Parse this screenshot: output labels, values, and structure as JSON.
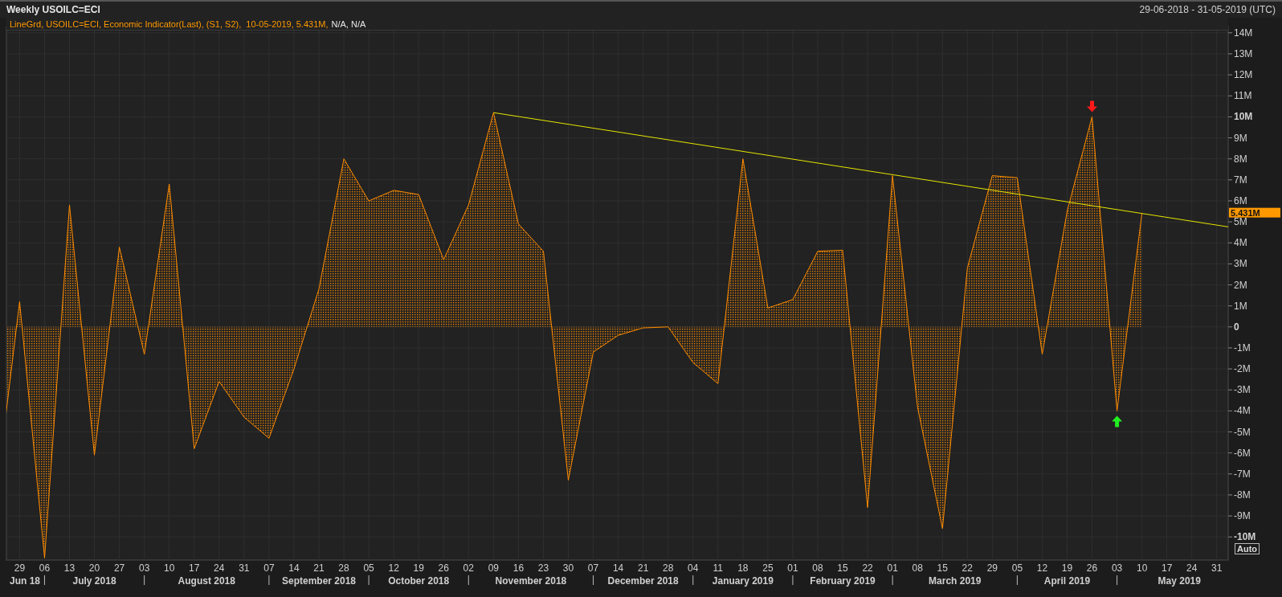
{
  "window": {
    "title": "Weekly USOILC=ECI",
    "date_range": "29-06-2018 - 31-05-2019 (UTC)"
  },
  "legend": {
    "series_text": "LineGrd, USOILC=ECI, Economic Indicator(Last), (S1, S2),  10-05-2019, 5.431M,",
    "extra_text": "N/A, N/A"
  },
  "chart": {
    "last_value_label": "5.431M",
    "autoscale_button": "Auto",
    "trendline": {
      "color": "#e6e600"
    },
    "signals": [
      {
        "kind": "sell",
        "color": "#ff1a1a"
      },
      {
        "kind": "buy",
        "color": "#22ee22"
      }
    ],
    "chart_data": {
      "type": "area",
      "categories": [
        null,
        "29",
        "06",
        "13",
        "20",
        "27",
        "03",
        "10",
        "17",
        "24",
        "31",
        "07",
        "14",
        "21",
        "28",
        "05",
        "12",
        "19",
        "26",
        "02",
        "09",
        "16",
        "23",
        "30",
        "07",
        "14",
        "21",
        "28",
        "04",
        "11",
        "18",
        "25",
        "01",
        "08",
        "15",
        "22",
        "01",
        "08",
        "15",
        "22",
        "29",
        "05",
        "12",
        "19",
        "26",
        "03",
        "10",
        "17",
        "24",
        "31"
      ],
      "series": [
        {
          "color": "#ff8c00",
          "values": [
            -8.6,
            1.2,
            -11,
            5.8,
            -6.1,
            3.8,
            -1.3,
            6.8,
            -5.8,
            -2.6,
            -4.3,
            -5.3,
            -2,
            1.8,
            8,
            6,
            6.5,
            6.3,
            3.2,
            5.8,
            10.2,
            4.9,
            3.6,
            -7.3,
            -1.2,
            -0.4,
            -0.05,
            0,
            -1.7,
            -2.7,
            8,
            0.9,
            1.3,
            3.6,
            3.65,
            -8.6,
            7.2,
            -3.8,
            -9.6,
            2.8,
            7.2,
            7.1,
            -1.3,
            5.5,
            10,
            -4,
            5.4,
            null,
            null,
            null
          ]
        }
      ],
      "ylim": [
        -11.1,
        14.3
      ],
      "grid": true,
      "yticks": [
        {
          "value": -10,
          "label": "-10M"
        },
        {
          "value": -9,
          "label": "-9M"
        },
        {
          "value": -8,
          "label": "-8M"
        },
        {
          "value": -7,
          "label": "-7M"
        },
        {
          "value": -6,
          "label": "-6M"
        },
        {
          "value": -5,
          "label": "-5M"
        },
        {
          "value": -4,
          "label": "-4M"
        },
        {
          "value": -3,
          "label": "-3M"
        },
        {
          "value": -2,
          "label": "-2M"
        },
        {
          "value": -1,
          "label": "-1M"
        },
        {
          "value": 0,
          "label": "0"
        },
        {
          "value": 1,
          "label": "1M"
        },
        {
          "value": 2,
          "label": "2M"
        },
        {
          "value": 3,
          "label": "3M"
        },
        {
          "value": 4,
          "label": "4M"
        },
        {
          "value": 5,
          "label": "5M"
        },
        {
          "value": 6,
          "label": "6M"
        },
        {
          "value": 7,
          "label": "7M"
        },
        {
          "value": 8,
          "label": "8M"
        },
        {
          "value": 9,
          "label": "9M"
        },
        {
          "value": 10,
          "label": "10M"
        },
        {
          "value": 11,
          "label": "11M"
        },
        {
          "value": 12,
          "label": "12M"
        },
        {
          "value": 13,
          "label": "13M"
        },
        {
          "value": 14,
          "label": "14M"
        }
      ]
    },
    "month_labels": [
      "Jun 18",
      "July 2018",
      "August 2018",
      "September 2018",
      "October 2018",
      "November 2018",
      "December 2018",
      "January 2019",
      "February 2019",
      "March 2019",
      "April 2019",
      "May 2019"
    ]
  }
}
